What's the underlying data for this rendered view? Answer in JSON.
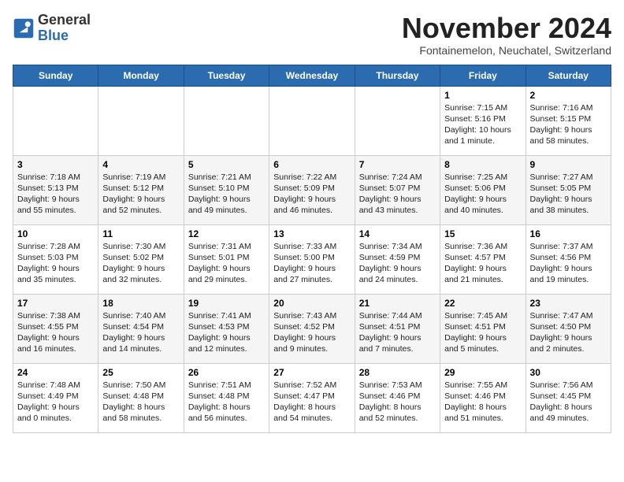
{
  "header": {
    "logo_line1": "General",
    "logo_line2": "Blue",
    "title": "November 2024",
    "subtitle": "Fontainemelon, Neuchatel, Switzerland"
  },
  "weekdays": [
    "Sunday",
    "Monday",
    "Tuesday",
    "Wednesday",
    "Thursday",
    "Friday",
    "Saturday"
  ],
  "weeks": [
    [
      {
        "day": "",
        "info": ""
      },
      {
        "day": "",
        "info": ""
      },
      {
        "day": "",
        "info": ""
      },
      {
        "day": "",
        "info": ""
      },
      {
        "day": "",
        "info": ""
      },
      {
        "day": "1",
        "info": "Sunrise: 7:15 AM\nSunset: 5:16 PM\nDaylight: 10 hours\nand 1 minute."
      },
      {
        "day": "2",
        "info": "Sunrise: 7:16 AM\nSunset: 5:15 PM\nDaylight: 9 hours\nand 58 minutes."
      }
    ],
    [
      {
        "day": "3",
        "info": "Sunrise: 7:18 AM\nSunset: 5:13 PM\nDaylight: 9 hours\nand 55 minutes."
      },
      {
        "day": "4",
        "info": "Sunrise: 7:19 AM\nSunset: 5:12 PM\nDaylight: 9 hours\nand 52 minutes."
      },
      {
        "day": "5",
        "info": "Sunrise: 7:21 AM\nSunset: 5:10 PM\nDaylight: 9 hours\nand 49 minutes."
      },
      {
        "day": "6",
        "info": "Sunrise: 7:22 AM\nSunset: 5:09 PM\nDaylight: 9 hours\nand 46 minutes."
      },
      {
        "day": "7",
        "info": "Sunrise: 7:24 AM\nSunset: 5:07 PM\nDaylight: 9 hours\nand 43 minutes."
      },
      {
        "day": "8",
        "info": "Sunrise: 7:25 AM\nSunset: 5:06 PM\nDaylight: 9 hours\nand 40 minutes."
      },
      {
        "day": "9",
        "info": "Sunrise: 7:27 AM\nSunset: 5:05 PM\nDaylight: 9 hours\nand 38 minutes."
      }
    ],
    [
      {
        "day": "10",
        "info": "Sunrise: 7:28 AM\nSunset: 5:03 PM\nDaylight: 9 hours\nand 35 minutes."
      },
      {
        "day": "11",
        "info": "Sunrise: 7:30 AM\nSunset: 5:02 PM\nDaylight: 9 hours\nand 32 minutes."
      },
      {
        "day": "12",
        "info": "Sunrise: 7:31 AM\nSunset: 5:01 PM\nDaylight: 9 hours\nand 29 minutes."
      },
      {
        "day": "13",
        "info": "Sunrise: 7:33 AM\nSunset: 5:00 PM\nDaylight: 9 hours\nand 27 minutes."
      },
      {
        "day": "14",
        "info": "Sunrise: 7:34 AM\nSunset: 4:59 PM\nDaylight: 9 hours\nand 24 minutes."
      },
      {
        "day": "15",
        "info": "Sunrise: 7:36 AM\nSunset: 4:57 PM\nDaylight: 9 hours\nand 21 minutes."
      },
      {
        "day": "16",
        "info": "Sunrise: 7:37 AM\nSunset: 4:56 PM\nDaylight: 9 hours\nand 19 minutes."
      }
    ],
    [
      {
        "day": "17",
        "info": "Sunrise: 7:38 AM\nSunset: 4:55 PM\nDaylight: 9 hours\nand 16 minutes."
      },
      {
        "day": "18",
        "info": "Sunrise: 7:40 AM\nSunset: 4:54 PM\nDaylight: 9 hours\nand 14 minutes."
      },
      {
        "day": "19",
        "info": "Sunrise: 7:41 AM\nSunset: 4:53 PM\nDaylight: 9 hours\nand 12 minutes."
      },
      {
        "day": "20",
        "info": "Sunrise: 7:43 AM\nSunset: 4:52 PM\nDaylight: 9 hours\nand 9 minutes."
      },
      {
        "day": "21",
        "info": "Sunrise: 7:44 AM\nSunset: 4:51 PM\nDaylight: 9 hours\nand 7 minutes."
      },
      {
        "day": "22",
        "info": "Sunrise: 7:45 AM\nSunset: 4:51 PM\nDaylight: 9 hours\nand 5 minutes."
      },
      {
        "day": "23",
        "info": "Sunrise: 7:47 AM\nSunset: 4:50 PM\nDaylight: 9 hours\nand 2 minutes."
      }
    ],
    [
      {
        "day": "24",
        "info": "Sunrise: 7:48 AM\nSunset: 4:49 PM\nDaylight: 9 hours\nand 0 minutes."
      },
      {
        "day": "25",
        "info": "Sunrise: 7:50 AM\nSunset: 4:48 PM\nDaylight: 8 hours\nand 58 minutes."
      },
      {
        "day": "26",
        "info": "Sunrise: 7:51 AM\nSunset: 4:48 PM\nDaylight: 8 hours\nand 56 minutes."
      },
      {
        "day": "27",
        "info": "Sunrise: 7:52 AM\nSunset: 4:47 PM\nDaylight: 8 hours\nand 54 minutes."
      },
      {
        "day": "28",
        "info": "Sunrise: 7:53 AM\nSunset: 4:46 PM\nDaylight: 8 hours\nand 52 minutes."
      },
      {
        "day": "29",
        "info": "Sunrise: 7:55 AM\nSunset: 4:46 PM\nDaylight: 8 hours\nand 51 minutes."
      },
      {
        "day": "30",
        "info": "Sunrise: 7:56 AM\nSunset: 4:45 PM\nDaylight: 8 hours\nand 49 minutes."
      }
    ]
  ]
}
